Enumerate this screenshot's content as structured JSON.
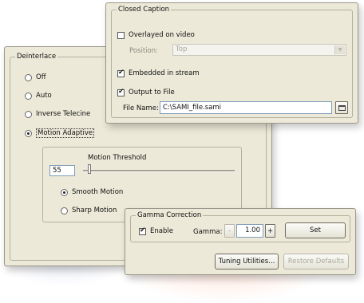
{
  "deinterlace": {
    "title": "Deinterlace",
    "options": [
      "Off",
      "Auto",
      "Inverse Telecine",
      "Motion Adaptive"
    ],
    "selected": "Motion Adaptive",
    "motion_threshold_label": "Motion Threshold",
    "motion_threshold_value": "55",
    "motion_options": [
      "Smooth Motion",
      "Sharp Motion"
    ],
    "motion_selected": "Smooth Motion"
  },
  "closed_caption": {
    "title": "Closed Caption",
    "overlayed_label": "Overlayed on video",
    "overlayed_checked": false,
    "position_label": "Position:",
    "position_value": "Top",
    "embedded_label": "Embedded in stream",
    "embedded_checked": true,
    "output_file_label": "Output to File",
    "output_file_checked": true,
    "file_name_label": "File Name:",
    "file_name_value": "C:\\SAMI_file.sami",
    "browse_icon": "browse-file-icon"
  },
  "gamma": {
    "title": "Gamma Correction",
    "enable_label": "Enable",
    "enable_checked": true,
    "gamma_label": "Gamma:",
    "gamma_value": "1.00",
    "decrement_label": "-",
    "increment_label": "+",
    "set_label": "Set"
  },
  "footer": {
    "tuning_label": "Tuning Utilities...",
    "restore_label": "Restore Defaults"
  }
}
